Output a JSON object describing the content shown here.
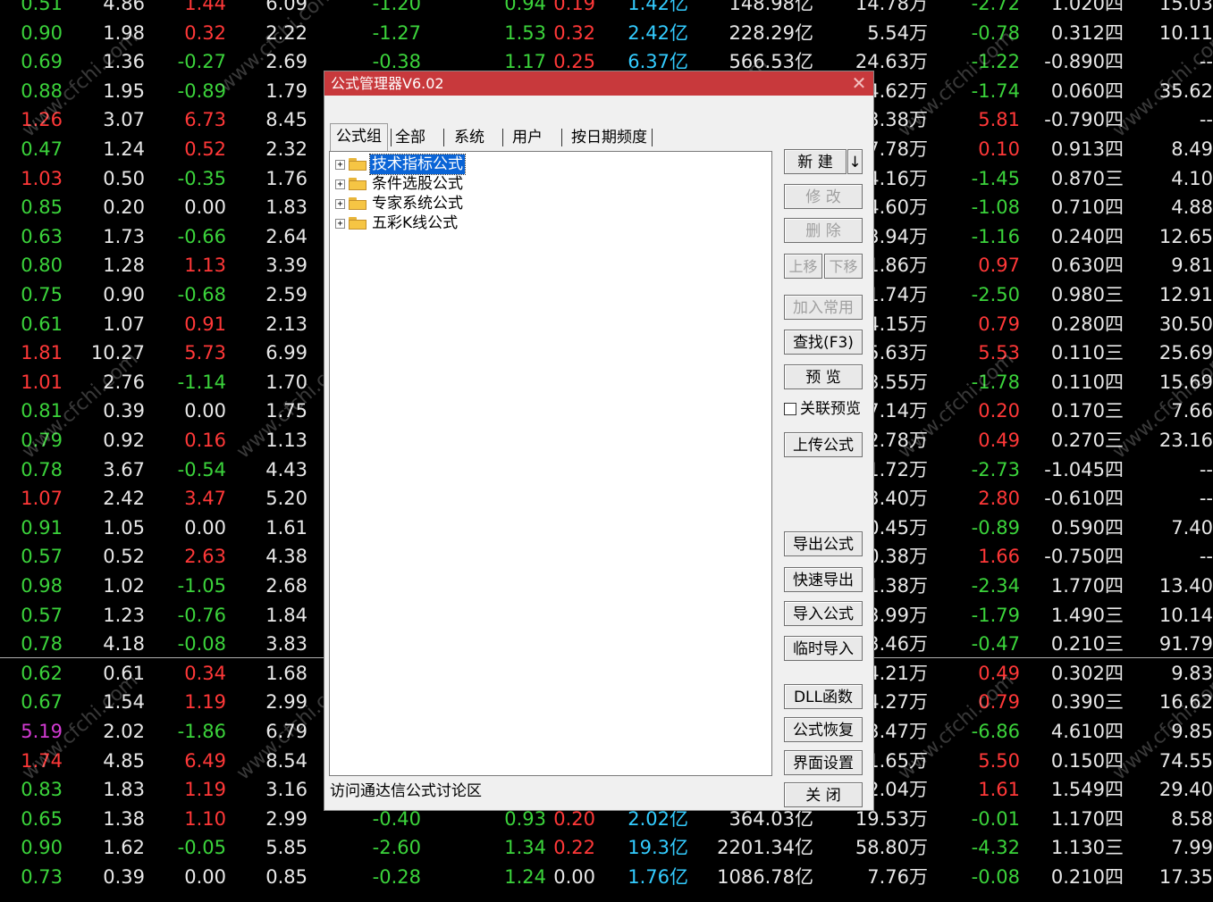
{
  "market_table": {
    "columns": [
      "c1",
      "c2",
      "c3",
      "c4",
      "c5",
      "c6",
      "c7",
      "c8",
      "c9",
      "c10",
      "c11",
      "c12",
      "c13"
    ],
    "rows": [
      [
        "0.51",
        "4.86",
        "1.44",
        "6.09",
        "-1.20",
        "0.94",
        "0.19",
        "1.42亿",
        "148.98亿",
        "14.78万",
        "-2.72",
        "1.020四",
        "15.03"
      ],
      [
        "0.90",
        "1.98",
        "0.32",
        "2.22",
        "-1.27",
        "1.53",
        "0.32",
        "2.42亿",
        "228.29亿",
        "5.54万",
        "-0.78",
        "0.312四",
        "10.11"
      ],
      [
        "0.69",
        "1.36",
        "-0.27",
        "2.69",
        "-0.38",
        "1.17",
        "0.25",
        "6.37亿",
        "566.53亿",
        "24.63万",
        "-1.22",
        "-0.890四",
        "--"
      ],
      [
        "0.88",
        "1.95",
        "-0.89",
        "1.79",
        "",
        "",
        "",
        "",
        "",
        "4.62万",
        "-1.74",
        "0.060四",
        "35.62"
      ],
      [
        "1.26",
        "3.07",
        "6.73",
        "8.45",
        "",
        "",
        "",
        "",
        "",
        "3.38万",
        "5.81",
        "-0.790四",
        "--"
      ],
      [
        "0.47",
        "1.24",
        "0.52",
        "2.32",
        "",
        "",
        "",
        "",
        "",
        "7.78万",
        "0.10",
        "0.913四",
        "8.49"
      ],
      [
        "1.03",
        "0.50",
        "-0.35",
        "1.76",
        "",
        "",
        "",
        "",
        "",
        "4.16万",
        "-1.45",
        "0.870三",
        "4.10"
      ],
      [
        "0.85",
        "0.20",
        "0.00",
        "1.83",
        "",
        "",
        "",
        "",
        "",
        "4.60万",
        "-1.08",
        "0.710四",
        "4.88"
      ],
      [
        "0.63",
        "1.73",
        "-0.66",
        "2.64",
        "",
        "",
        "",
        "",
        "",
        "3.94万",
        "-1.16",
        "0.240四",
        "12.65"
      ],
      [
        "0.80",
        "1.28",
        "1.13",
        "3.39",
        "",
        "",
        "",
        "",
        "",
        "1.86万",
        "0.97",
        "0.630四",
        "9.81"
      ],
      [
        "0.75",
        "0.90",
        "-0.68",
        "2.59",
        "",
        "",
        "",
        "",
        "",
        "1.74万",
        "-2.50",
        "0.980三",
        "12.91"
      ],
      [
        "0.61",
        "1.07",
        "0.91",
        "2.13",
        "",
        "",
        "",
        "",
        "",
        "4.15万",
        "0.79",
        "0.280四",
        "30.50"
      ],
      [
        "1.81",
        "10.27",
        "5.73",
        "6.99",
        "",
        "",
        "",
        "",
        "",
        "5.63万",
        "5.53",
        "0.110三",
        "25.69"
      ],
      [
        "1.01",
        "2.76",
        "-1.14",
        "1.70",
        "",
        "",
        "",
        "",
        "",
        "3.55万",
        "-1.78",
        "0.110四",
        "15.69"
      ],
      [
        "0.81",
        "0.39",
        "0.00",
        "1.75",
        "",
        "",
        "",
        "",
        "",
        "7.14万",
        "0.20",
        "0.170三",
        "7.66"
      ],
      [
        "0.79",
        "0.92",
        "0.16",
        "1.13",
        "",
        "",
        "",
        "",
        "",
        "2.78万",
        "0.49",
        "0.270三",
        "23.16"
      ],
      [
        "0.78",
        "3.67",
        "-0.54",
        "4.43",
        "",
        "",
        "",
        "",
        "",
        "1.72万",
        "-2.73",
        "-1.045四",
        "--"
      ],
      [
        "1.07",
        "2.42",
        "3.47",
        "5.20",
        "",
        "",
        "",
        "",
        "",
        "3.40万",
        "2.80",
        "-0.610四",
        "--"
      ],
      [
        "0.91",
        "1.05",
        "0.00",
        "1.61",
        "",
        "",
        "",
        "",
        "",
        "0.45万",
        "-0.89",
        "0.590四",
        "7.40"
      ],
      [
        "0.57",
        "0.52",
        "2.63",
        "4.38",
        "",
        "",
        "",
        "",
        "",
        "0.38万",
        "1.66",
        "-0.750四",
        "--"
      ],
      [
        "0.98",
        "1.02",
        "-1.05",
        "2.68",
        "",
        "",
        "",
        "",
        "",
        "1.38万",
        "-2.34",
        "1.770四",
        "13.40"
      ],
      [
        "0.57",
        "1.23",
        "-0.76",
        "1.84",
        "",
        "",
        "",
        "",
        "",
        "3.99万",
        "-1.79",
        "1.490三",
        "10.14"
      ],
      [
        "0.78",
        "4.18",
        "-0.08",
        "3.83",
        "",
        "",
        "",
        "",
        "",
        "3.46万",
        "-0.47",
        "0.210三",
        "91.79"
      ],
      [
        "0.62",
        "0.61",
        "0.34",
        "1.68",
        "",
        "",
        "",
        "",
        "",
        "4.21万",
        "0.49",
        "0.302四",
        "9.83"
      ],
      [
        "0.67",
        "1.54",
        "1.19",
        "2.99",
        "",
        "",
        "",
        "",
        "",
        "4.27万",
        "0.79",
        "0.390三",
        "16.62"
      ],
      [
        "5.19",
        "2.02",
        "-1.86",
        "6.79",
        "",
        "",
        "",
        "",
        "",
        "3.47万",
        "-6.86",
        "4.610四",
        "9.85"
      ],
      [
        "1.74",
        "4.85",
        "6.49",
        "8.54",
        "",
        "",
        "",
        "",
        "",
        "1.65万",
        "5.50",
        "0.150四",
        "74.55"
      ],
      [
        "0.83",
        "1.83",
        "1.19",
        "3.16",
        "",
        "",
        "",
        "",
        "",
        "2.04万",
        "1.61",
        "1.549四",
        "29.40"
      ],
      [
        "0.65",
        "1.38",
        "1.10",
        "2.99",
        "-0.40",
        "0.93",
        "0.20",
        "2.02亿",
        "364.03亿",
        "19.53万",
        "-0.01",
        "1.170四",
        "8.58"
      ],
      [
        "0.90",
        "1.62",
        "-0.05",
        "5.85",
        "-2.60",
        "1.34",
        "0.22",
        "19.3亿",
        "2201.34亿",
        "58.80万",
        "-4.32",
        "1.130三",
        "7.99"
      ],
      [
        "0.73",
        "0.39",
        "0.00",
        "0.85",
        "-0.28",
        "1.24",
        "0.00",
        "1.76亿",
        "1086.78亿",
        "7.76万",
        "-0.08",
        "0.210四",
        "17.35"
      ]
    ],
    "row_colors": [
      [
        "grn",
        "wht",
        "red",
        "wht",
        "grn",
        "red",
        "grn",
        "cyn",
        "wht",
        "wht",
        "grn",
        "wht",
        "wht"
      ]
    ]
  },
  "watermark": "www.cfchi.com",
  "dialog": {
    "title": "公式管理器V6.02",
    "close_glyph": "✕",
    "tabs": [
      "公式组",
      "全部",
      "系统",
      "用户",
      "按日期频度"
    ],
    "tree": [
      {
        "label": "技术指标公式",
        "selected": true
      },
      {
        "label": "条件选股公式",
        "selected": false
      },
      {
        "label": "专家系统公式",
        "selected": false
      },
      {
        "label": "五彩K线公式",
        "selected": false
      }
    ],
    "expander_glyph": "+",
    "status_link": "访问通达信公式讨论区",
    "buttons": {
      "new": "新 建",
      "new_arrow": "↓",
      "modify": "修 改",
      "delete": "删 除",
      "move_up": "上移",
      "move_down": "下移",
      "add_common": "加入常用",
      "find": "查找(F3)",
      "preview": "预 览",
      "linked_preview": "关联预览",
      "upload": "上传公式",
      "export": "导出公式",
      "quick_export": "快速导出",
      "import": "导入公式",
      "temp_import": "临时导入",
      "dll": "DLL函数",
      "restore": "公式恢复",
      "ui_settings": "界面设置",
      "close": "关 闭"
    }
  }
}
